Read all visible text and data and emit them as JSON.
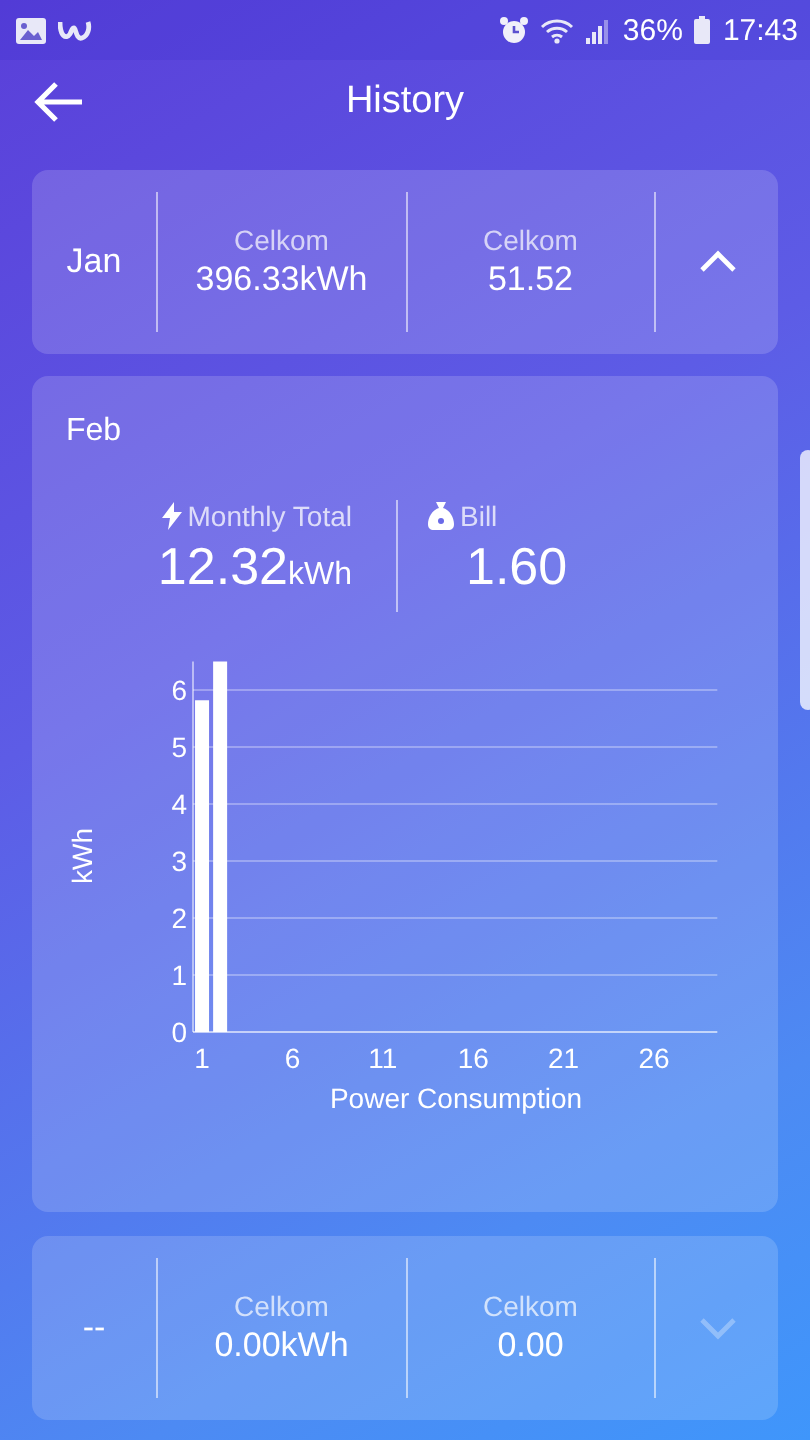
{
  "status_bar": {
    "battery": "36%",
    "time": "17:43"
  },
  "header": {
    "title": "History"
  },
  "months": [
    {
      "kind": "summary",
      "month": "Jan",
      "energy_label": "Celkom",
      "energy": "396.33kWh",
      "bill_label": "Celkom",
      "bill": "51.52",
      "expanded": true,
      "disabled": false
    },
    {
      "kind": "detail",
      "month": "Feb",
      "total_label": "Monthly Total",
      "total": "12.32",
      "total_unit": "kWh",
      "bill_label": "Bill",
      "bill": "1.60",
      "chart_data": {
        "type": "bar",
        "xlabel": "Power Consumption",
        "ylabel": "kWh",
        "x": [
          1,
          2
        ],
        "values": [
          5.82,
          6.5
        ],
        "xlim": [
          0.5,
          29.5
        ],
        "ylim": [
          0,
          6.5
        ],
        "xticks": [
          1,
          6,
          11,
          16,
          21,
          26
        ],
        "yticks": [
          0,
          1,
          2,
          3,
          4,
          5,
          6
        ],
        "grid": true
      }
    },
    {
      "kind": "summary",
      "month": "--",
      "energy_label": "Celkom",
      "energy": "0.00kWh",
      "bill_label": "Celkom",
      "bill": "0.00",
      "expanded": false,
      "disabled": true
    }
  ]
}
